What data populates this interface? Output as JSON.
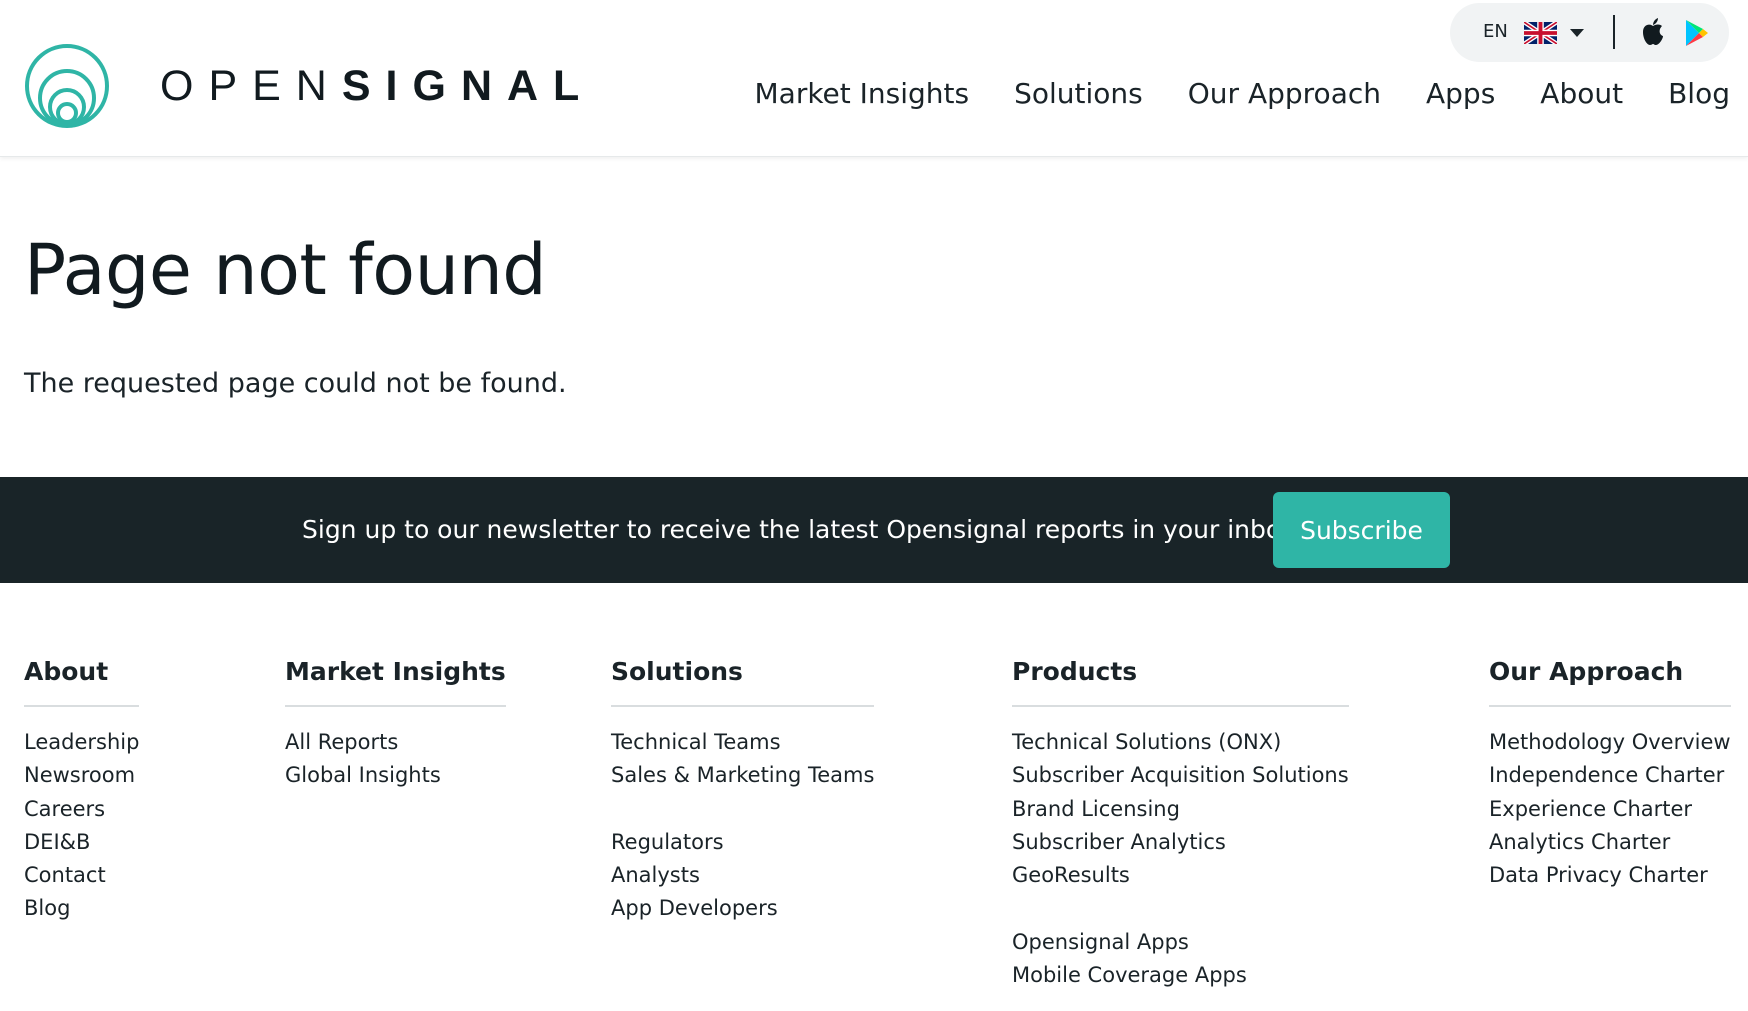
{
  "brand": {
    "name_light": "OPEN",
    "name_bold": "SIGNAL",
    "accent_color": "#2fb5a6",
    "dark_color": "#192428"
  },
  "util": {
    "language": "EN",
    "flag_icon": "uk-flag-icon",
    "apple_icon": "apple-icon",
    "play_icon": "google-play-icon"
  },
  "nav": {
    "items": [
      {
        "label": "Market Insights"
      },
      {
        "label": "Solutions"
      },
      {
        "label": "Our Approach"
      },
      {
        "label": "Apps"
      },
      {
        "label": "About"
      },
      {
        "label": "Blog"
      }
    ]
  },
  "main": {
    "title": "Page not found",
    "message": "The requested page could not be found."
  },
  "newsletter": {
    "text": "Sign up to our newsletter to receive the latest Opensignal reports in your inbox",
    "button_label": "Subscribe"
  },
  "footer": {
    "about": {
      "heading": "About",
      "links": [
        "Leadership",
        "Newsroom",
        "Careers",
        "DEI&B",
        "Contact",
        "Blog"
      ]
    },
    "market_insights": {
      "heading": "Market Insights",
      "links": [
        "All Reports",
        "Global Insights"
      ]
    },
    "solutions": {
      "heading": "Solutions",
      "links": [
        "Technical Teams",
        "Sales & Marketing Teams",
        "Regulators",
        "Analysts",
        "App Developers"
      ]
    },
    "products": {
      "heading": "Products",
      "links": [
        "Technical Solutions (ONX)",
        "Subscriber Acquisition Solutions",
        "Brand Licensing",
        "Subscriber Analytics",
        "GeoResults",
        "Opensignal Apps",
        "Mobile Coverage Apps"
      ]
    },
    "our_approach": {
      "heading": "Our Approach",
      "links": [
        "Methodology Overview",
        "Independence Charter",
        "Experience Charter",
        "Analytics Charter",
        "Data Privacy Charter"
      ]
    }
  }
}
